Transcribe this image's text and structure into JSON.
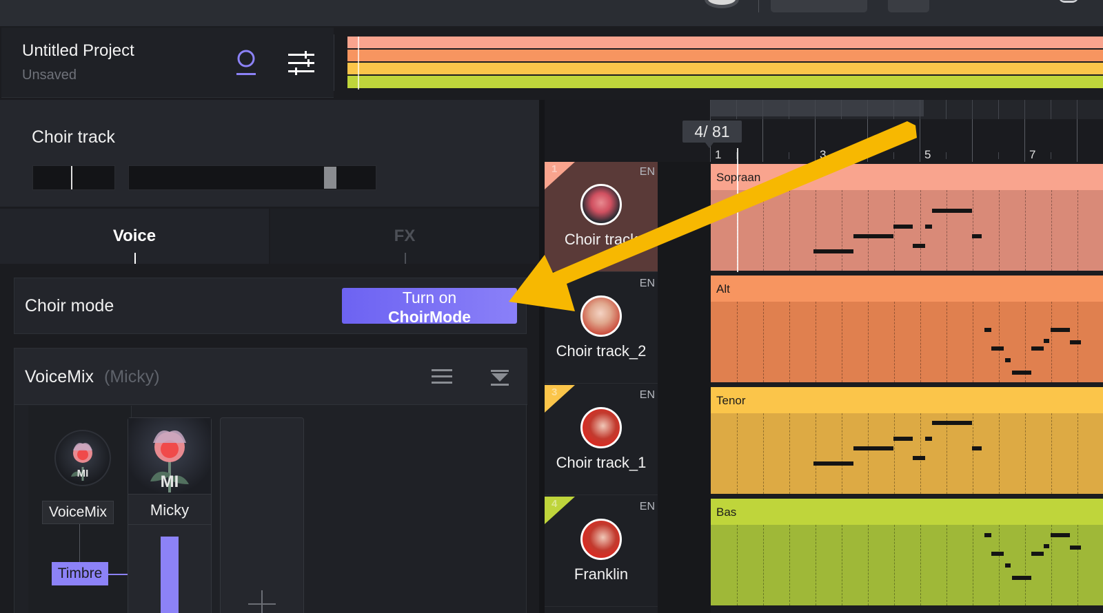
{
  "project": {
    "title": "Untitled Project",
    "status": "Unsaved"
  },
  "colors": {
    "accent": "#8c82f7",
    "soprano": "#f9a48e",
    "alt": "#f79560",
    "tenor": "#fbc54a",
    "bas": "#bfd53b",
    "arrow": "#f7b801"
  },
  "track_panel": {
    "name": "Choir track"
  },
  "tabs": [
    {
      "label": "Voice"
    },
    {
      "label": "FX"
    }
  ],
  "choir_mode": {
    "label": "Choir mode",
    "button_line1": "Turn on",
    "button_line2": "ChoirMode"
  },
  "voicemix": {
    "title": "VoiceMix",
    "subtitle": "(Micky)",
    "mix_label": "VoiceMix",
    "timbre_label": "Timbre",
    "voice_name": "Micky",
    "monogram": "MI"
  },
  "timeline": {
    "time_badge": "4/  81",
    "bar_numbers": [
      "1",
      "3",
      "5",
      "7"
    ]
  },
  "tracks": [
    {
      "num": "1",
      "lang": "EN",
      "name": "Choir track",
      "lane_label": "Sopraan"
    },
    {
      "num": "",
      "lang": "EN",
      "name": "Choir track_2",
      "lane_label": "Alt"
    },
    {
      "num": "3",
      "lang": "EN",
      "name": "Choir track_1",
      "lane_label": "Tenor"
    },
    {
      "num": "4",
      "lang": "EN",
      "name": "Franklin",
      "lane_label": "Bas"
    }
  ],
  "icons": [
    "person-icon",
    "mixer-icon",
    "list-icon",
    "collapse-icon",
    "plus-icon",
    "arrow-annotation"
  ]
}
